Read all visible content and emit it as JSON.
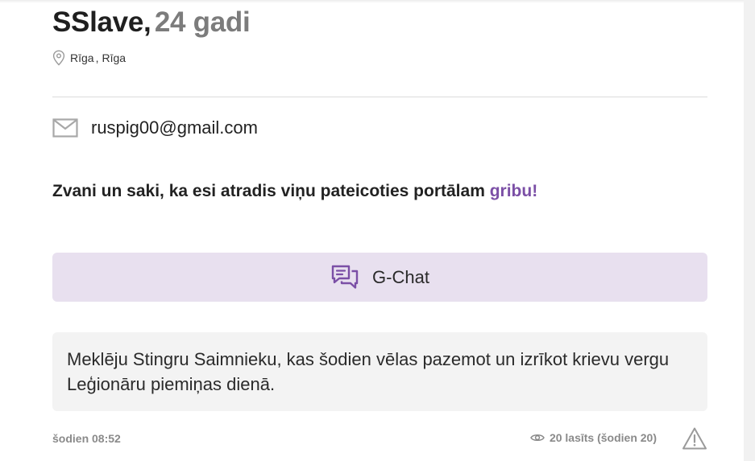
{
  "profile": {
    "name": "SSlave,",
    "age": "24 gadi",
    "location_city": "Rīga",
    "location_separator": ",",
    "location_region": "Rīga"
  },
  "contact": {
    "email": "ruspig00@gmail.com"
  },
  "call_prompt": {
    "text": "Zvani un saki, ka esi atradis viņu pateicoties portālam ",
    "brand": "gribu!"
  },
  "chat_button": {
    "label": "G-Chat"
  },
  "description": {
    "text": "Meklēju Stingru Saimnieku, kas šodien vēlas pazemot un izrīkot krievu vergu Leģionāru piemiņas dienā."
  },
  "meta": {
    "posted": "šodien 08:52",
    "views": "20 lasīts (šodien 20)"
  },
  "colors": {
    "accent": "#7b4fa6",
    "chat_button_bg": "#e8e0ef",
    "description_bg": "#f3f3f3"
  },
  "icons": {
    "location": "map-pin-icon",
    "email": "envelope-icon",
    "chat": "chat-bubbles-icon",
    "views": "eye-icon",
    "report": "warning-triangle-icon"
  }
}
